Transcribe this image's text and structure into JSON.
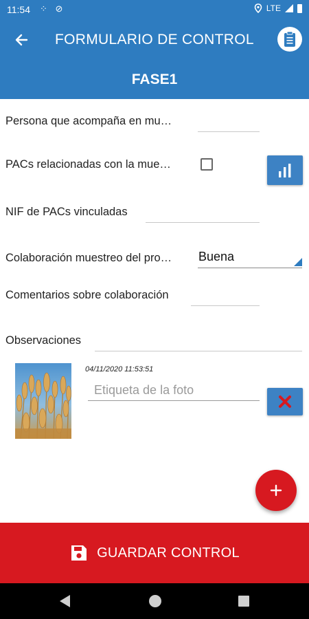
{
  "status_bar": {
    "time": "11:54",
    "network": "LTE"
  },
  "app_bar": {
    "title": "FORMULARIO DE CONTROL",
    "back_icon": "arrow-left-icon",
    "action_icon": "clipboard-icon"
  },
  "phase": {
    "title": "FASE1"
  },
  "form": {
    "persona_label": "Persona que acompaña en mu…",
    "persona_value": "",
    "pacs_label": "PACs relacionadas con la mue…",
    "pacs_checked": false,
    "pacs_button_icon": "bar-chart-icon",
    "nif_label": "NIF de PACs vinculadas",
    "nif_value": "",
    "colaboracion_label": "Colaboración muestreo del pro…",
    "colaboracion_selected": "Buena",
    "comentarios_label": "Comentarios sobre colaboración",
    "comentarios_value": "",
    "observaciones_label": "Observaciones",
    "observaciones_value": ""
  },
  "photo": {
    "timestamp": "04/11/2020 11:53:51",
    "label_placeholder": "Etiqueta de la foto",
    "label_value": "",
    "delete_icon": "close-x-icon"
  },
  "fab": {
    "icon": "plus-icon"
  },
  "save_button": {
    "label": "GUARDAR CONTROL",
    "icon": "floppy-disk-icon"
  },
  "colors": {
    "primary": "#2e7cc0",
    "button_blue": "#3d82c4",
    "accent_red": "#d71920"
  }
}
